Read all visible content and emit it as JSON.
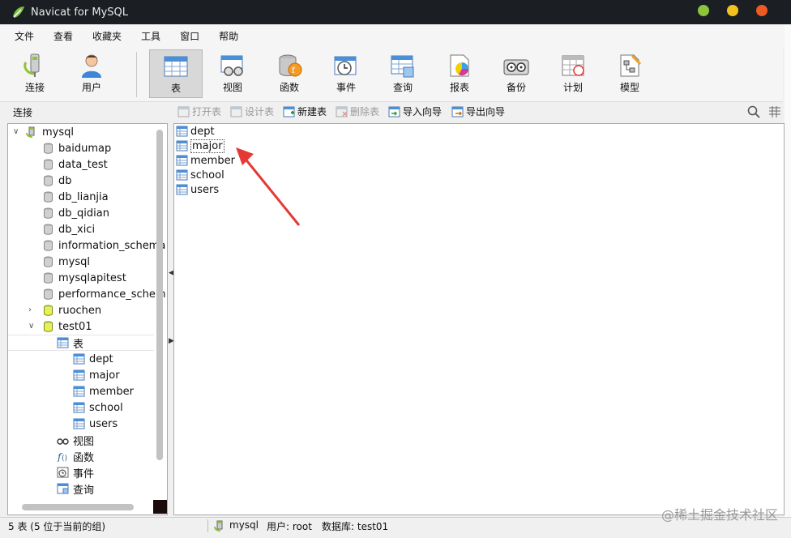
{
  "window": {
    "title": "Navicat for MySQL"
  },
  "menu": [
    "文件",
    "查看",
    "收藏夹",
    "工具",
    "窗口",
    "帮助"
  ],
  "toolbar": {
    "buttons": [
      {
        "label": "连接",
        "icon": "connection-icon"
      },
      {
        "label": "用户",
        "icon": "user-icon"
      },
      {
        "label": "表",
        "icon": "table-icon",
        "active": true
      },
      {
        "label": "视图",
        "icon": "view-icon"
      },
      {
        "label": "函数",
        "icon": "function-icon"
      },
      {
        "label": "事件",
        "icon": "event-icon"
      },
      {
        "label": "查询",
        "icon": "query-icon"
      },
      {
        "label": "报表",
        "icon": "report-icon"
      },
      {
        "label": "备份",
        "icon": "backup-icon"
      },
      {
        "label": "计划",
        "icon": "schedule-icon"
      },
      {
        "label": "模型",
        "icon": "model-icon"
      }
    ]
  },
  "subbar": {
    "connection_title": "连接",
    "buttons": [
      {
        "label": "打开表",
        "enabled": false
      },
      {
        "label": "设计表",
        "enabled": false
      },
      {
        "label": "新建表",
        "enabled": true
      },
      {
        "label": "删除表",
        "enabled": false
      },
      {
        "label": "导入向导",
        "enabled": true
      },
      {
        "label": "导出向导",
        "enabled": true
      }
    ]
  },
  "tree": {
    "connection": "mysql",
    "databases": [
      "baidumap",
      "data_test",
      "db",
      "db_lianjia",
      "db_qidian",
      "db_xici",
      "information_schema",
      "mysql",
      "mysqlapitest",
      "performance_schem",
      "ruochen",
      "test01"
    ],
    "open_db_group": "表",
    "tables": [
      "dept",
      "major",
      "member",
      "school",
      "users"
    ],
    "other_groups": [
      "视图",
      "函数",
      "事件",
      "查询"
    ]
  },
  "main": {
    "objects": [
      "dept",
      "major",
      "member",
      "school",
      "users"
    ],
    "focused": "major"
  },
  "status": {
    "count": "5 表 (5 位于当前的组)",
    "connection": "mysql",
    "user": "用户: root",
    "database": "数据库: test01",
    "watermark": "@稀土掘金技术社区"
  },
  "colors": {
    "titlebar": "#1b1f23",
    "traffic_green": "#8cc43b",
    "traffic_yellow": "#f4c21f",
    "traffic_red": "#ee5a24",
    "arrow": "#e53935"
  }
}
